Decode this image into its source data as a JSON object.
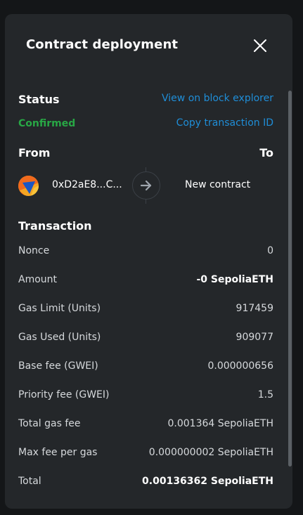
{
  "modal": {
    "title": "Contract deployment"
  },
  "status": {
    "heading": "Status",
    "value": "Confirmed",
    "view_explorer_label": "View on block explorer",
    "copy_txid_label": "Copy transaction ID",
    "value_color": "#28a745",
    "link_color": "#1f8ed8"
  },
  "transfer": {
    "from_heading": "From",
    "to_heading": "To",
    "from_address": "0xD2aE8...C...",
    "to_value": "New contract"
  },
  "transaction": {
    "heading": "Transaction",
    "rows": [
      {
        "label": "Nonce",
        "value": "0",
        "bold": false
      },
      {
        "label": "Amount",
        "value": "-0 SepoliaETH",
        "bold": true
      },
      {
        "label": "Gas Limit (Units)",
        "value": "917459",
        "bold": false
      },
      {
        "label": "Gas Used (Units)",
        "value": "909077",
        "bold": false
      },
      {
        "label": "Base fee (GWEI)",
        "value": "0.000000656",
        "bold": false
      },
      {
        "label": "Priority fee (GWEI)",
        "value": "1.5",
        "bold": false
      },
      {
        "label": "Total gas fee",
        "value": "0.001364 SepoliaETH",
        "bold": false
      },
      {
        "label": "Max fee per gas",
        "value": "0.000000002 SepoliaETH",
        "bold": false
      },
      {
        "label": "Total",
        "value": "0.00136362 SepoliaETH",
        "bold": true
      }
    ]
  },
  "icons": {
    "close": "close-icon",
    "arrow": "arrow-right-icon",
    "avatar": "account-avatar"
  }
}
